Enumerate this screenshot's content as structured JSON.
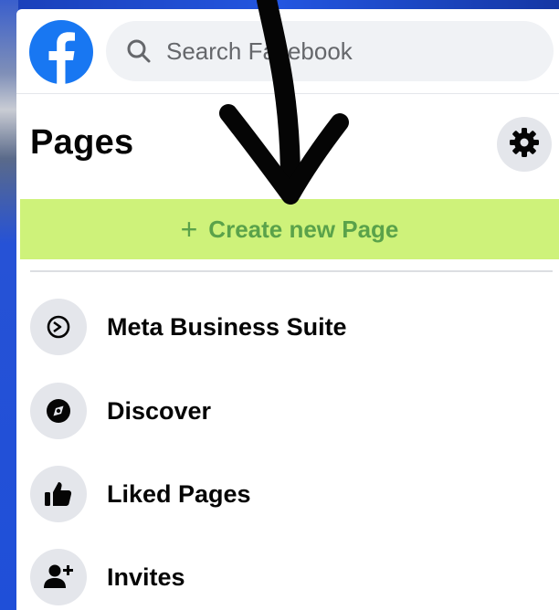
{
  "header": {
    "search_placeholder": "Search Facebook"
  },
  "pages": {
    "title": "Pages",
    "create_label": "Create new Page",
    "create_plus": "+"
  },
  "menu": [
    {
      "label": "Meta Business Suite",
      "icon": "meta-business-suite-icon"
    },
    {
      "label": "Discover",
      "icon": "compass-icon"
    },
    {
      "label": "Liked Pages",
      "icon": "thumbs-up-icon"
    },
    {
      "label": "Invites",
      "icon": "person-add-icon"
    }
  ],
  "colors": {
    "facebook_blue": "#1877f2",
    "highlight": "#cef27a",
    "create_text": "#5aa24a",
    "icon_bg": "#e4e6eb",
    "search_bg": "#f0f2f5"
  }
}
